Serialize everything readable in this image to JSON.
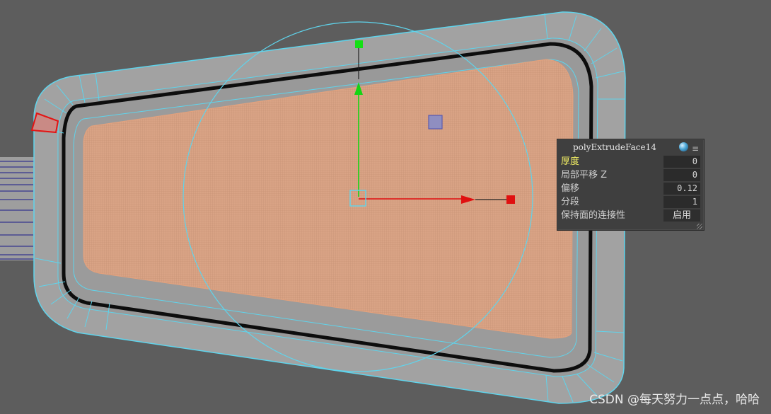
{
  "hud": {
    "title": "polyExtrudeFace14",
    "rows": [
      {
        "label": "厚度",
        "value": "0",
        "active": true
      },
      {
        "label": "局部平移 Z",
        "value": "0"
      },
      {
        "label": "偏移",
        "value": "0.12"
      },
      {
        "label": "分段",
        "value": "1"
      },
      {
        "label": "保持面的连接性",
        "value": "启用"
      }
    ],
    "menu_icon": "menu-icon"
  },
  "watermark": "CSDN @每天努力一点点，哈哈",
  "colors": {
    "background": "#5d5d5d",
    "mesh": "#9a9a9a",
    "wire": "#5fd4ec",
    "selected_face": "#d8a184",
    "manip_y": "#14d414",
    "manip_x": "#e01010"
  }
}
